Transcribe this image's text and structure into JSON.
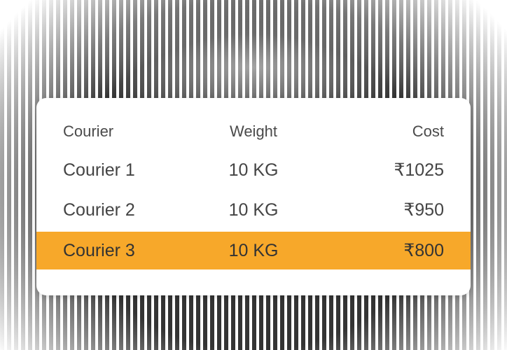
{
  "table": {
    "headers": {
      "courier": "Courier",
      "weight": "Weight",
      "cost": "Cost"
    },
    "rows": [
      {
        "courier": "Courier 1",
        "weight": "10 KG",
        "cost": "₹1025",
        "highlighted": false
      },
      {
        "courier": "Courier 2",
        "weight": "10 KG",
        "cost": "₹950",
        "highlighted": false
      },
      {
        "courier": "Courier 3",
        "weight": "10 KG",
        "cost": "₹800",
        "highlighted": true
      }
    ]
  },
  "colors": {
    "highlight": "#f7a82a",
    "card": "#ffffff",
    "text": "#444444"
  }
}
